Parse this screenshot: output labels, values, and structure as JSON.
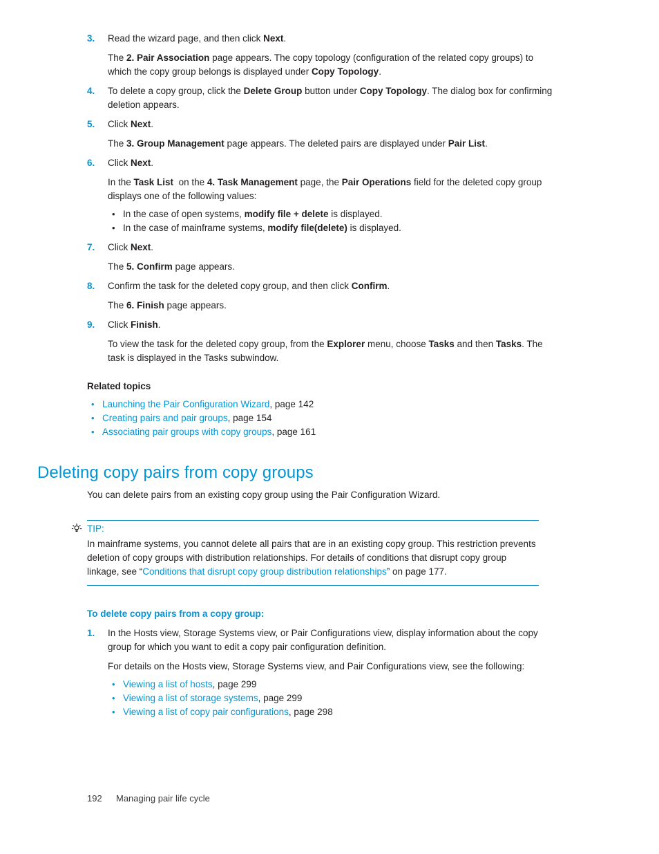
{
  "document": {
    "steps_top": [
      {
        "number": "3.",
        "text_html": "Read the wizard page, and then click <b>Next</b>.",
        "sub": [
          "The <b>2. Pair Association</b> page appears. The copy topology (configuration of the related copy groups) to which the copy group belongs is displayed under <b>Copy Topology</b>."
        ]
      },
      {
        "number": "4.",
        "text_html": "To delete a copy group, click the <b>Delete Group</b> button under <b>Copy Topology</b>. The dialog box for confirming deletion appears.",
        "sub": []
      },
      {
        "number": "5.",
        "text_html": "Click <b>Next</b>.",
        "sub": [
          "The <b>3. Group Management</b> page appears. The deleted pairs are displayed under <b>Pair List</b>."
        ]
      },
      {
        "number": "6.",
        "text_html": "Click <b>Next</b>.",
        "sub": [
          "In the <b>Task List</b>&nbsp; on the <b>4. Task Management</b> page, the <b>Pair Operations</b> field for the deleted copy group displays one of the following values:"
        ],
        "bullets": [
          "In the case of open systems, <b>modify file + delete</b> is displayed.",
          "In the case of mainframe systems, <b>modify file(delete)</b> is displayed."
        ]
      },
      {
        "number": "7.",
        "text_html": "Click <b>Next</b>.",
        "sub": [
          "The <b>5. Confirm</b> page appears."
        ]
      },
      {
        "number": "8.",
        "text_html": "Confirm the task for the deleted copy group, and then click <b>Confirm</b>.",
        "sub": [
          "The <b>6. Finish</b> page appears."
        ]
      },
      {
        "number": "9.",
        "text_html": "Click <b>Finish</b>.",
        "sub": [
          "To view the task for the deleted copy group, from the <b>Explorer</b> menu, choose <b>Tasks</b> and then <b>Tasks</b>. The task is displayed in the Tasks subwindow."
        ]
      }
    ],
    "related_topics": {
      "heading": "Related topics",
      "items": [
        {
          "link": "Launching the Pair Configuration Wizard",
          "suffix": ", page 142"
        },
        {
          "link": "Creating pairs and pair groups",
          "suffix": ", page 154"
        },
        {
          "link": "Associating pair groups with copy groups",
          "suffix": ", page 161"
        }
      ]
    },
    "section": {
      "heading": "Deleting copy pairs from copy groups",
      "intro": "You can delete pairs from an existing copy group using the Pair Configuration Wizard."
    },
    "tip": {
      "icon": "lightbulb-icon",
      "label": "TIP:",
      "body_before": "In mainframe systems, you cannot delete all pairs that are in an existing copy group. This restriction prevents deletion of copy groups with distribution relationships. For details of conditions that disrupt copy group linkage, see “",
      "body_link": "Conditions that disrupt copy group distribution relationships",
      "body_after": "” on page 177."
    },
    "procedure": {
      "heading": "To delete copy pairs from a copy group:",
      "steps": [
        {
          "number": "1.",
          "text": "In the Hosts view, Storage Systems view, or Pair Configurations view, display information about the copy group for which you want to edit a copy pair configuration definition.",
          "sub": "For details on the Hosts view, Storage Systems view, and Pair Configurations view, see the following:",
          "bullets": [
            {
              "link": "Viewing a list of hosts",
              "suffix": ", page 299"
            },
            {
              "link": "Viewing a list of storage systems",
              "suffix": ", page 299"
            },
            {
              "link": "Viewing a list of copy pair configurations",
              "suffix": ", page 298"
            }
          ]
        }
      ]
    },
    "footer": {
      "page_number": "192",
      "chapter_title": "Managing pair life cycle"
    },
    "colors": {
      "accent_blue": "#0096d6",
      "rule_blue": "#0082bd",
      "body_text": "#231f20"
    }
  }
}
